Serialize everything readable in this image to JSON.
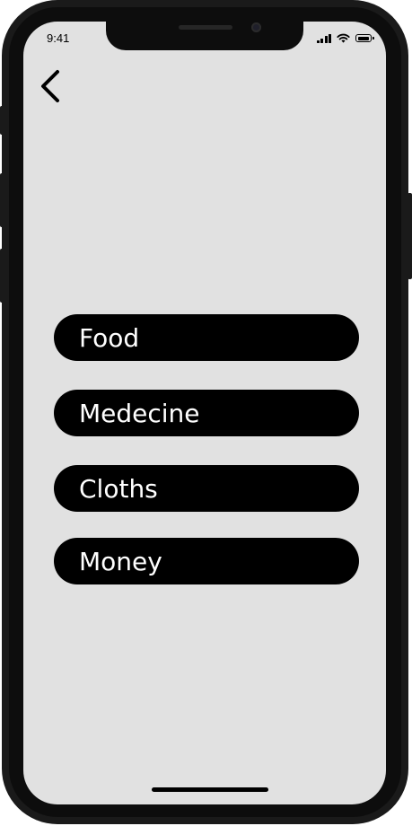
{
  "status_bar": {
    "time": "9:41",
    "icons": [
      "cellular-signal-icon",
      "wifi-icon",
      "battery-icon"
    ]
  },
  "navigation": {
    "back_icon": "chevron-left-icon"
  },
  "menu": {
    "items": [
      {
        "label": "Food"
      },
      {
        "label": "Medecine"
      },
      {
        "label": "Cloths"
      },
      {
        "label": "Money"
      }
    ]
  },
  "colors": {
    "screen_background": "#e1e1e1",
    "button_background": "#000000",
    "button_text": "#ffffff",
    "device_frame": "#1a1a1a"
  }
}
